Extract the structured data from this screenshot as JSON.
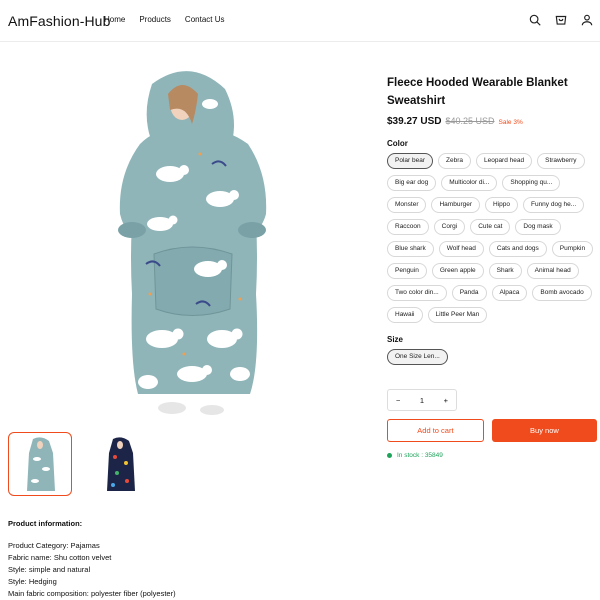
{
  "header": {
    "logo": "AmFashion-Hub",
    "nav": [
      "Home",
      "Products",
      "Contact Us"
    ],
    "icons": [
      "search-icon",
      "cart-icon",
      "user-icon"
    ]
  },
  "product": {
    "title": "Fleece Hooded Wearable Blanket Sweatshirt",
    "price": "$39.27 USD",
    "old_price": "$40.25 USD",
    "sale": "Sale 3%",
    "color_label": "Color",
    "colors": [
      "Polar bear",
      "Zebra",
      "Leopard head",
      "Strawberry",
      "Big ear dog",
      "Multicolor di...",
      "Shopping qu...",
      "Monster",
      "Hamburger",
      "Hippo",
      "Funny dog he...",
      "Raccoon",
      "Corgi",
      "Cute cat",
      "Dog mask",
      "Blue shark",
      "Wolf head",
      "Cats and dogs",
      "Pumpkin",
      "Penguin",
      "Green apple",
      "Shark",
      "Animal head",
      "Two color din...",
      "Panda",
      "Alpaca",
      "Bomb avocado",
      "Hawaii",
      "Little Peer Man"
    ],
    "selected_color": "Polar bear",
    "size_label": "Size",
    "sizes": [
      "One Size Len..."
    ],
    "quantity": "1",
    "qty_minus": "−",
    "qty_plus": "+",
    "add_to_cart": "Add to cart",
    "buy_now": "Buy now",
    "stock": "In stock : 35849"
  },
  "info": {
    "title": "Product information:",
    "lines": [
      "Product Category: Pajamas",
      "Fabric name: Shu cotton velvet",
      "Style: simple and natural",
      "Style: Hedging",
      "Main fabric composition: polyester fiber (polyester)"
    ]
  },
  "colors": {
    "accent": "#f04b1c",
    "stock": "#1ea35a",
    "blanket": "#8fb5b9"
  }
}
